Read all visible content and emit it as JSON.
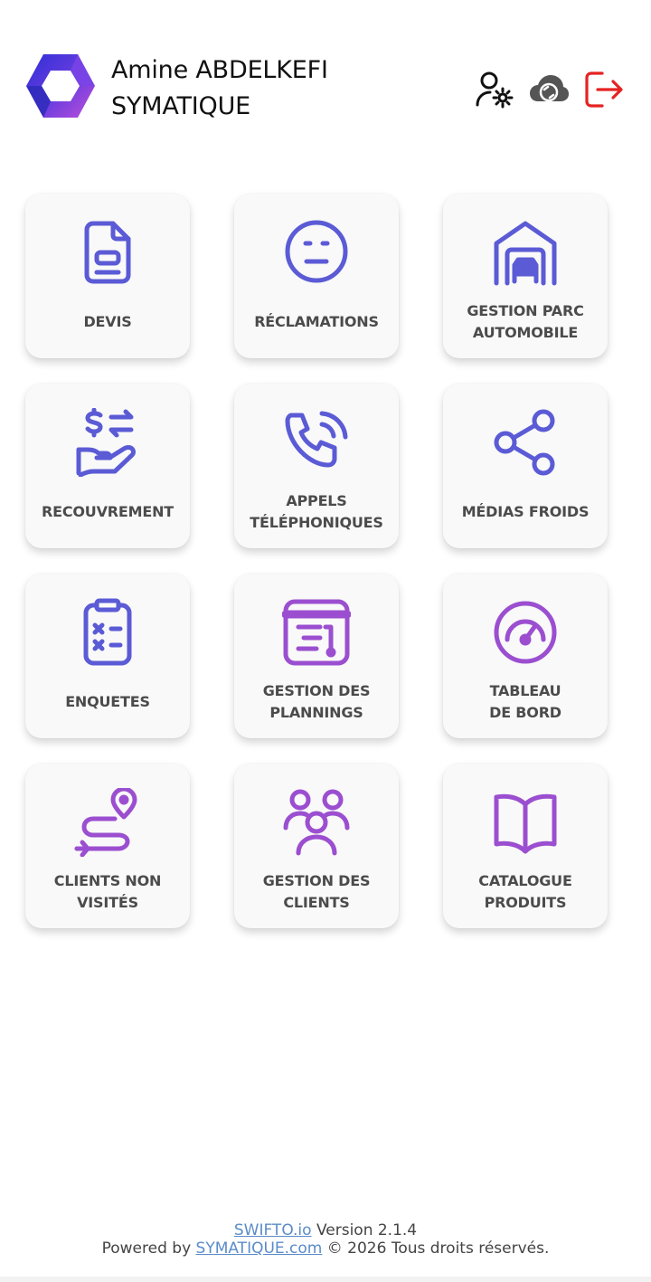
{
  "user": {
    "name": "Amine ABDELKEFI",
    "company": "SYMATIQUE"
  },
  "header_icons": [
    {
      "name": "user-settings-icon",
      "color": "#111111"
    },
    {
      "name": "sync-cloud-icon",
      "color": "#555555"
    },
    {
      "name": "logout-icon",
      "color": "#e52222"
    }
  ],
  "colors": {
    "primary": "#5b5bd6",
    "purple": "#9b4fd0",
    "label": "#4b4b4b",
    "logout": "#e52222"
  },
  "tiles": [
    {
      "label": "DEVIS",
      "icon": "document-icon",
      "color": "#5b5bd6"
    },
    {
      "label": "RÉCLAMATIONS",
      "icon": "neutral-face-icon",
      "color": "#5b5bd6"
    },
    {
      "label": "GESTION PARC\nAUTOMOBILE",
      "icon": "garage-car-icon",
      "color": "#5b5bd6"
    },
    {
      "label": "RECOUVREMENT",
      "icon": "hand-money-icon",
      "color": "#5b5bd6"
    },
    {
      "label": "APPELS\nTÉLÉPHONIQUES",
      "icon": "phone-call-icon",
      "color": "#5b5bd6"
    },
    {
      "label": "MÉDIAS FROIDS",
      "icon": "share-icon",
      "color": "#5b5bd6"
    },
    {
      "label": "ENQUETES",
      "icon": "clipboard-checklist-icon",
      "color": "#5b5bd6"
    },
    {
      "label": "GESTION DES\nPLANNINGS",
      "icon": "planning-icon",
      "color": "#9b4fd0"
    },
    {
      "label": "TABLEAU\nDE BORD",
      "icon": "gauge-icon",
      "color": "#9b4fd0"
    },
    {
      "label": "CLIENTS NON\nVISITÉS",
      "icon": "route-icon",
      "color": "#9b4fd0"
    },
    {
      "label": "GESTION DES\nCLIENTS",
      "icon": "users-icon",
      "color": "#9b4fd0"
    },
    {
      "label": "CATALOGUE\nPRODUITS",
      "icon": "open-book-icon",
      "color": "#9b4fd0"
    }
  ],
  "footer": {
    "swifto_link": "SWIFTO.io",
    "version": "Version 2.1.4",
    "powered_by": "Powered by",
    "symatique_link": "SYMATIQUE.com",
    "copyright": "© 2026 Tous droits réservés."
  }
}
